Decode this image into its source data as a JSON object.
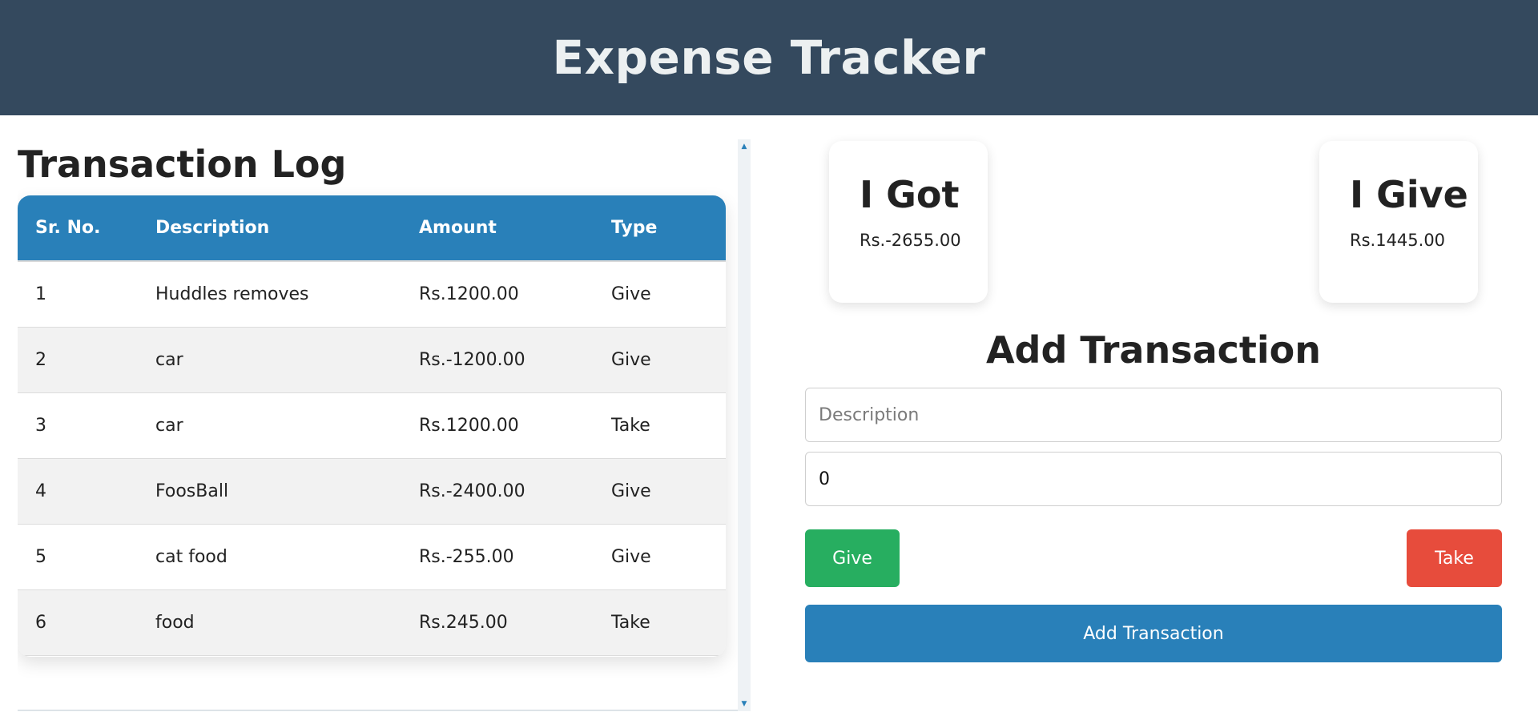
{
  "header": {
    "title": "Expense Tracker"
  },
  "log": {
    "title": "Transaction Log",
    "columns": [
      "Sr. No.",
      "Description",
      "Amount",
      "Type"
    ],
    "rows": [
      {
        "sr": "1",
        "description": "Huddles removes",
        "amount": "Rs.1200.00",
        "type": "Give"
      },
      {
        "sr": "2",
        "description": "car",
        "amount": "Rs.-1200.00",
        "type": "Give"
      },
      {
        "sr": "3",
        "description": "car",
        "amount": "Rs.1200.00",
        "type": "Take"
      },
      {
        "sr": "4",
        "description": "FoosBall",
        "amount": "Rs.-2400.00",
        "type": "Give"
      },
      {
        "sr": "5",
        "description": "cat food",
        "amount": "Rs.-255.00",
        "type": "Give"
      },
      {
        "sr": "6",
        "description": "food",
        "amount": "Rs.245.00",
        "type": "Take"
      }
    ]
  },
  "summary": {
    "got": {
      "label": "I Got",
      "amount": "Rs.-2655.00"
    },
    "give": {
      "label": "I Give",
      "amount": "Rs.1445.00"
    }
  },
  "form": {
    "title": "Add Transaction",
    "description_placeholder": "Description",
    "description_value": "",
    "amount_value": "0",
    "give_label": "Give",
    "take_label": "Take",
    "submit_label": "Add Transaction"
  },
  "colors": {
    "header": "#34495e",
    "primary": "#2980b9",
    "give": "#27ae60",
    "take": "#e74c3c"
  }
}
